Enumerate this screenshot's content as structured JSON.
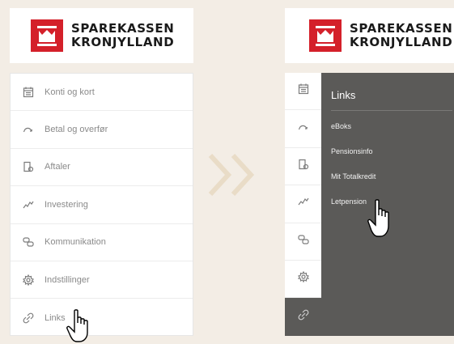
{
  "brand": {
    "line1": "SPAREKASSEN",
    "line2": "KRONJYLLAND",
    "color": "#d4202a"
  },
  "left_menu": {
    "items": [
      {
        "label": "Konti og kort",
        "icon": "calendar-icon"
      },
      {
        "label": "Betal og overfør",
        "icon": "arrow-curve-icon"
      },
      {
        "label": "Aftaler",
        "icon": "document-icon"
      },
      {
        "label": "Investering",
        "icon": "line-graph-icon"
      },
      {
        "label": "Kommunikation",
        "icon": "chat-bubbles-icon"
      },
      {
        "label": "Indstillinger",
        "icon": "gear-icon"
      },
      {
        "label": "Links",
        "icon": "link-icon"
      }
    ]
  },
  "right_menu": {
    "submenu_title": "Links",
    "links": [
      {
        "label": "eBoks"
      },
      {
        "label": "Pensionsinfo"
      },
      {
        "label": "Mit Totalkredit"
      },
      {
        "label": "Letpension"
      }
    ],
    "panel_color": "#5b5a58"
  },
  "arrow_color": "#e9dcc7"
}
